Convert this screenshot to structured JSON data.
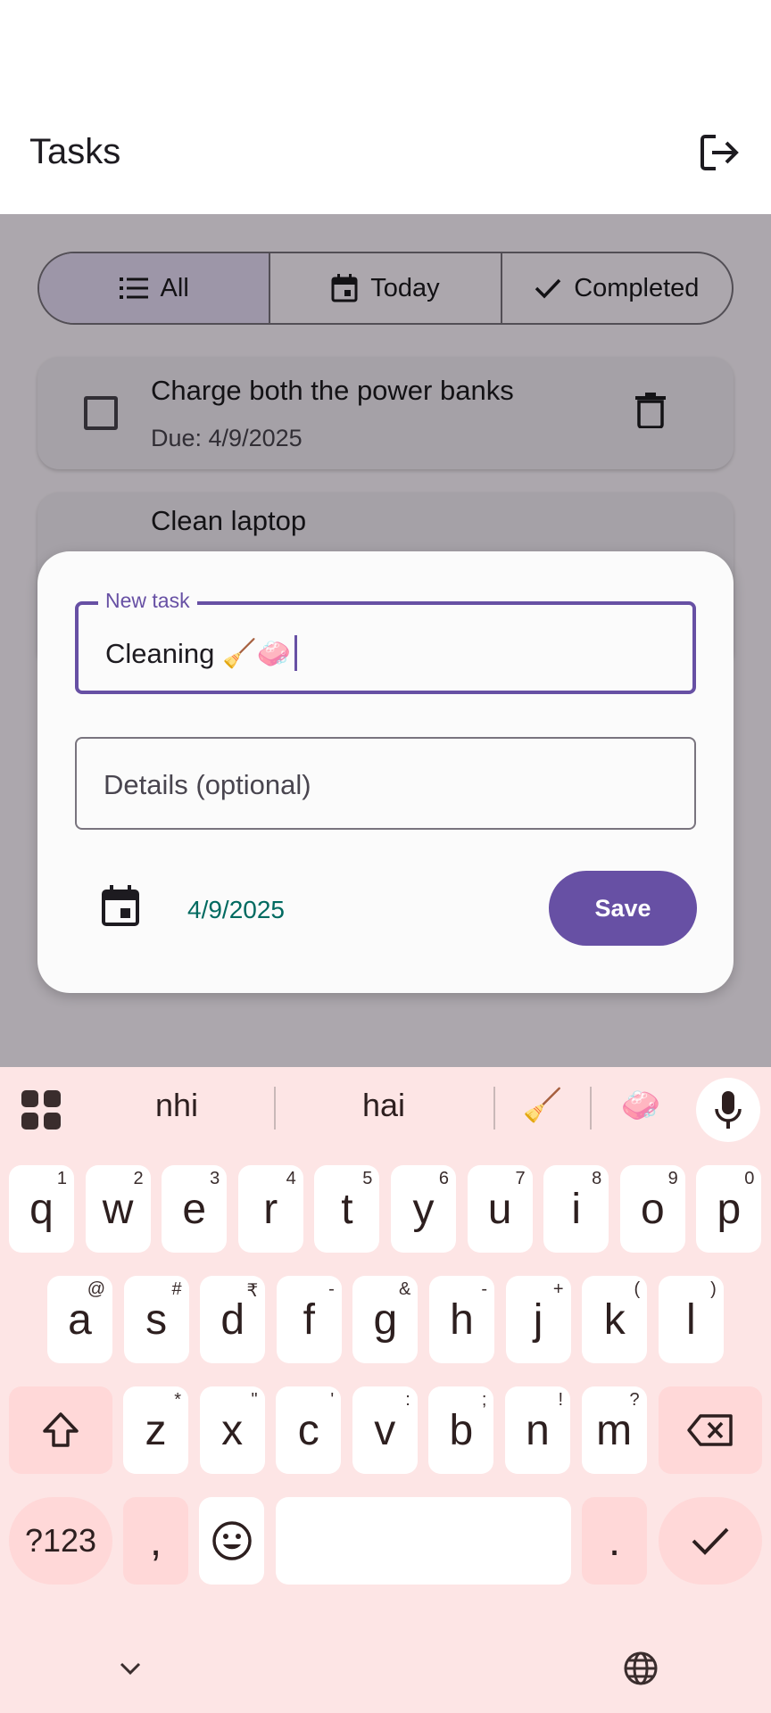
{
  "app": {
    "title": "Tasks",
    "logout_icon": "logout-icon"
  },
  "filters": [
    {
      "label": "All",
      "icon": "list-icon",
      "selected": true
    },
    {
      "label": "Today",
      "icon": "calendar-icon",
      "selected": false
    },
    {
      "label": "Completed",
      "icon": "check-icon",
      "selected": false
    }
  ],
  "tasks": [
    {
      "title": "Charge both the power banks",
      "due": "Due: 4/9/2025",
      "checked": false
    },
    {
      "title": "Clean laptop",
      "due": "",
      "checked": false
    }
  ],
  "dialog": {
    "title_label": "New task",
    "title_value": "Cleaning 🧹🧼",
    "details_placeholder": "Details (optional)",
    "date": "4/9/2025",
    "save_label": "Save"
  },
  "keyboard": {
    "suggestions": [
      "nhi",
      "hai",
      "🧹",
      "🧼"
    ],
    "row1": [
      [
        "q",
        "1"
      ],
      [
        "w",
        "2"
      ],
      [
        "e",
        "3"
      ],
      [
        "r",
        "4"
      ],
      [
        "t",
        "5"
      ],
      [
        "y",
        "6"
      ],
      [
        "u",
        "7"
      ],
      [
        "i",
        "8"
      ],
      [
        "o",
        "9"
      ],
      [
        "p",
        "0"
      ]
    ],
    "row2": [
      [
        "a",
        "@"
      ],
      [
        "s",
        "#"
      ],
      [
        "d",
        "₹"
      ],
      [
        "f",
        "-"
      ],
      [
        "g",
        "&"
      ],
      [
        "h",
        "-"
      ],
      [
        "j",
        "+"
      ],
      [
        "k",
        "("
      ],
      [
        "l",
        ")"
      ]
    ],
    "row3": [
      [
        "z",
        "*"
      ],
      [
        "x",
        "\""
      ],
      [
        "c",
        "'"
      ],
      [
        "v",
        ":"
      ],
      [
        "b",
        ";"
      ],
      [
        "n",
        "!"
      ],
      [
        "m",
        "?"
      ]
    ],
    "symbols_label": "?123",
    "comma_label": ",",
    "period_label": "."
  },
  "colors": {
    "primary": "#6750a4",
    "date_text": "#006a60",
    "keyboard_bg": "#fde5e5"
  }
}
